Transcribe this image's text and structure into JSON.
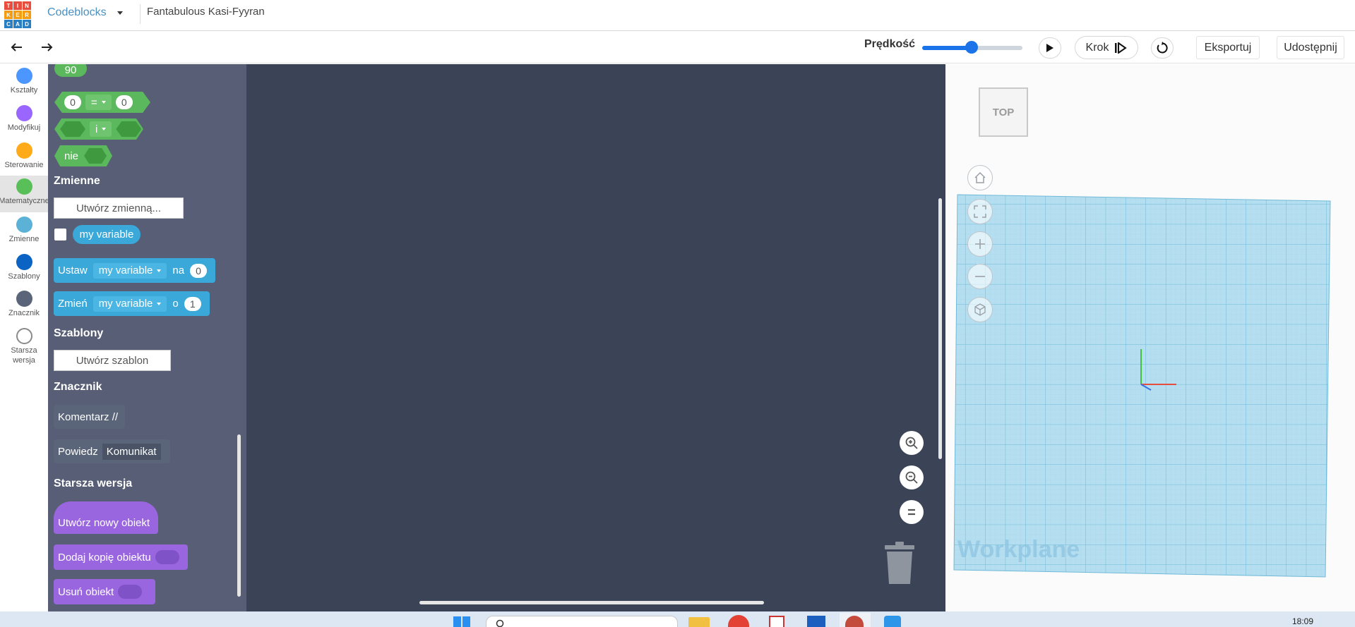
{
  "logo": {
    "letters": [
      "T",
      "I",
      "N",
      "K",
      "E",
      "R",
      "C",
      "A",
      "D"
    ],
    "colors": [
      "#e74c3c",
      "#e74c3c",
      "#e74c3c",
      "#f39c12",
      "#f39c12",
      "#f39c12",
      "#2a7fc3",
      "#2a7fc3",
      "#2a7fc3"
    ]
  },
  "header": {
    "app_name": "Codeblocks",
    "project_name": "Fantabulous Kasi-Fyyran"
  },
  "toolbar": {
    "speed_label": "Prędkość",
    "speed_value": 0.46,
    "step_label": "Krok",
    "export_label": "Eksportuj",
    "share_label": "Udostępnij"
  },
  "categories": [
    {
      "label": "Kształty",
      "color": "#4c97ff"
    },
    {
      "label": "Modyfikuj",
      "color": "#9966ff"
    },
    {
      "label": "Sterowanie",
      "color": "#ffab19"
    },
    {
      "label": "Matematyczne",
      "color": "#59c059",
      "active": true
    },
    {
      "label": "Zmienne",
      "color": "#5cb1d6"
    },
    {
      "label": "Szablony",
      "color": "#0b63c4"
    },
    {
      "label": "Znacznik",
      "color": "#5a6579"
    },
    {
      "label": "Starsza",
      "label2": "wersja",
      "color": "#ffffff"
    }
  ],
  "palette": {
    "number_block": "90",
    "compare": {
      "left": "0",
      "op": "=",
      "right": "0"
    },
    "logic_op": "i",
    "not_label": "nie",
    "variables": {
      "title": "Zmienne",
      "create_button": "Utwórz zmienną...",
      "variable_name": "my variable",
      "set_label": "Ustaw",
      "set_to": "na",
      "set_value": "0",
      "change_label": "Zmień",
      "change_by": "o",
      "change_value": "1"
    },
    "templates": {
      "title": "Szablony",
      "create_button": "Utwórz szablon"
    },
    "marker": {
      "title": "Znacznik",
      "comment": "Komentarz //",
      "say": "Powiedz",
      "say_value": "Komunikat"
    },
    "legacy": {
      "title": "Starsza wersja",
      "create_object": "Utwórz nowy obiekt",
      "add_copy": "Dodaj kopię obiektu",
      "remove_object": "Usuń obiekt"
    }
  },
  "viewer": {
    "viewcube_label": "TOP",
    "workplane_label": "Workplane"
  },
  "taskbar": {
    "time": "18:09"
  }
}
